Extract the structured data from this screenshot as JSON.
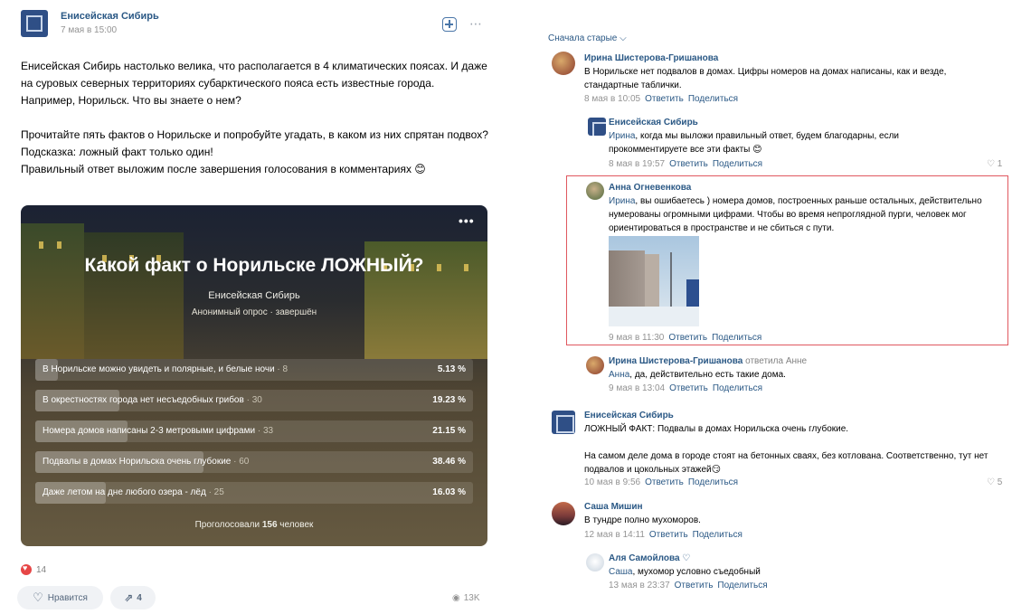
{
  "post": {
    "author": "Енисейская Сибирь",
    "date": "7 мая в 15:00",
    "more_icon": "⋯",
    "text_p1": "Енисейская Сибирь настолько велика, что располагается в 4 климатических поясах. И даже на суровых северных территориях субарктического пояса есть известные города. Например, Норильск. Что вы знаете о нем?",
    "text_p2": "Прочитайте пять фактов о Норильске и попробуйте угадать, в каком из них спрятан подвох?\nПодсказка: ложный факт только один!\nПравильный ответ выложим после завершения голосования в комментариях 😊",
    "likes_count": "14",
    "like_label": "Нравится",
    "share_count": "4",
    "views": "13K"
  },
  "poll": {
    "title": "Какой факт о Норильске ЛОЖНЫЙ?",
    "author": "Енисейская Сибирь",
    "meta": "Анонимный опрос · завершён",
    "dots": "•••",
    "options": [
      {
        "label": "В Норильске можно увидеть и полярные, и белые ночи",
        "count": " · 8",
        "percent": "5.13 %",
        "value": 5.13
      },
      {
        "label": "В окрестностях города нет несъедобных грибов",
        "count": " · 30",
        "percent": "19.23 %",
        "value": 19.23
      },
      {
        "label": "Номера домов написаны 2-3 метровыми цифрами",
        "count": " · 33",
        "percent": "21.15 %",
        "value": 21.15
      },
      {
        "label": "Подвалы в домах Норильска очень глубокие",
        "count": " · 60",
        "percent": "38.46 %",
        "value": 38.46
      },
      {
        "label": "Даже летом на дне любого озера - лёд",
        "count": " · 25",
        "percent": "16.03 %",
        "value": 16.03
      }
    ],
    "total_prefix": "Проголосовали ",
    "total_count": "156",
    "total_suffix": " человек"
  },
  "comments": {
    "sort_label": "Сначала старые ⌵",
    "reply_label": "Ответить",
    "share_label": "Поделиться",
    "items": [
      {
        "name": "Ирина Шистерова-Гришанова",
        "text": "В Норильске нет подвалов в домах. Цифры номеров на домах написаны, как и везде, стандартные таблички.",
        "date": "8 мая в 10:05"
      },
      {
        "name": "Енисейская Сибирь",
        "mention": "Ирина",
        "text": ", когда мы выложи правильный ответ, будем благодарны, если прокомментируете все эти факты 😊",
        "date": "8 мая в 19:57",
        "likes": "♡ 1"
      },
      {
        "name": "Анна Огневенкова",
        "mention": "Ирина",
        "text": ", вы ошибаетесь ) номера домов, построенных раньше остальных, действительно нумерованы огромными цифрами. Чтобы во время непроглядной пурги, человек мог ориентироваться в пространстве и не сбиться с пути.",
        "date": "9 мая в 11:30"
      },
      {
        "name": "Ирина Шистерова-Гришанова",
        "reply_to": " ответила Анне",
        "mention": "Анна",
        "text": ", да, действительно есть такие дома.",
        "date": "9 мая в 13:04"
      },
      {
        "name": "Енисейская Сибирь",
        "text": "ЛОЖНЫЙ ФАКТ: Подвалы в домах Норильска очень глубокие.",
        "text2": "На самом деле дома в городе стоят на бетонных сваях, без котлована. Соответственно, тут нет подвалов и цокольных этажей😏",
        "date": "10 мая в 9:56",
        "likes": "♡ 5"
      },
      {
        "name": "Саша Мишин",
        "text": "В тундре полно мухоморов.",
        "date": "12 мая в 14:11"
      },
      {
        "name": "Аля Самойлова ♡",
        "mention": "Саша",
        "text": ", мухомор условно съедобный",
        "date": "13 мая в 23:37"
      }
    ]
  }
}
